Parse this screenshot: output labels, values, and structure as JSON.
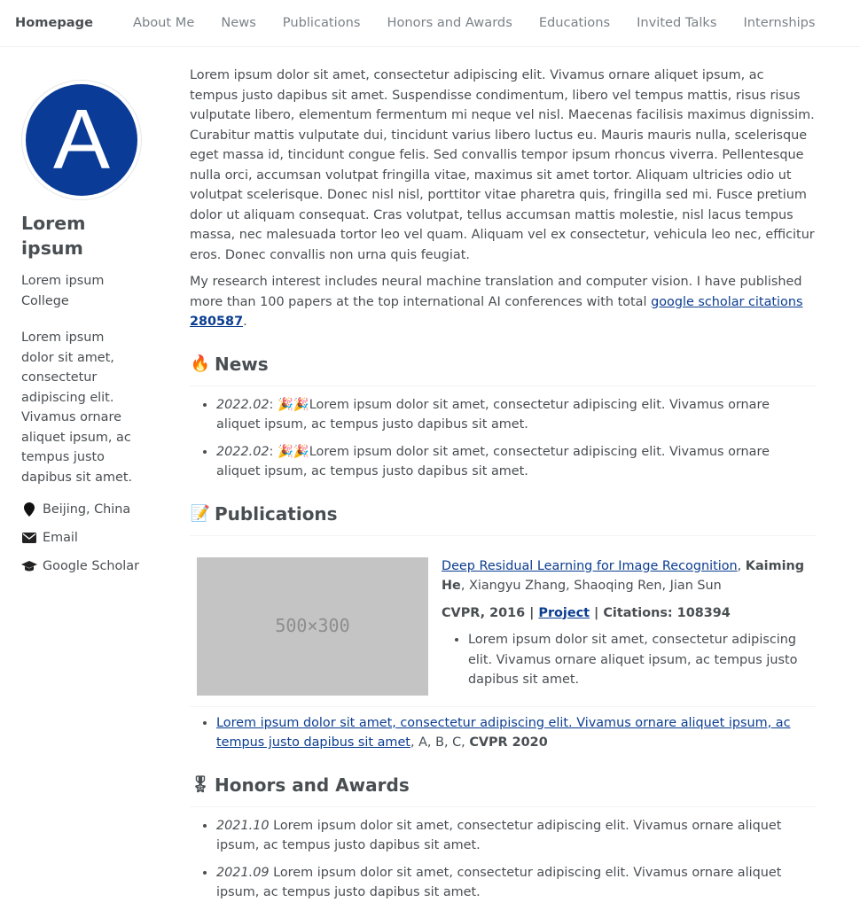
{
  "nav": {
    "home": "Homepage",
    "items": [
      "About Me",
      "News",
      "Publications",
      "Honors and Awards",
      "Educations",
      "Invited Talks",
      "Internships"
    ]
  },
  "sidebar": {
    "avatar_letter": "A",
    "avatar_color": "#0a3b97",
    "name": "Lorem ipsum",
    "affiliation": "Lorem ipsum College",
    "bio": "Lorem ipsum dolor sit amet, consectetur adipiscing elit. Vivamus ornare aliquet ipsum, ac tempus justo dapibus sit amet.",
    "location": "Beijing, China",
    "email_label": "Email",
    "scholar_label": "Google Scholar"
  },
  "about": {
    "paragraph1": "Lorem ipsum dolor sit amet, consectetur adipiscing elit. Vivamus ornare aliquet ipsum, ac tempus justo dapibus sit amet. Suspendisse condimentum, libero vel tempus mattis, risus risus vulputate libero, elementum fermentum mi neque vel nisl. Maecenas facilisis maximus dignissim. Curabitur mattis vulputate dui, tincidunt varius libero luctus eu. Mauris mauris nulla, scelerisque eget massa id, tincidunt congue felis. Sed convallis tempor ipsum rhoncus viverra. Pellentesque nulla orci, accumsan volutpat fringilla vitae, maximus sit amet tortor. Aliquam ultricies odio ut volutpat scelerisque. Donec nisl nisl, porttitor vitae pharetra quis, fringilla sed mi. Fusce pretium dolor ut aliquam consequat. Cras volutpat, tellus accumsan mattis molestie, nisl lacus tempus massa, nec malesuada tortor leo vel quam. Aliquam vel ex consectetur, vehicula leo nec, efficitur eros. Donec convallis non urna quis feugiat.",
    "paragraph2_prefix": "My research interest includes neural machine translation and computer vision. I have published more than 100 papers at the top international AI conferences with total ",
    "citations_link_text": "google scholar citations ",
    "citations_count": "280587",
    "paragraph2_suffix": "."
  },
  "news": {
    "title": "News",
    "emoji": "🔥",
    "items": [
      {
        "date": "2022.02",
        "sep": ": ",
        "emoji": "🎉🎉",
        "text": "Lorem ipsum dolor sit amet, consectetur adipiscing elit. Vivamus ornare aliquet ipsum, ac tempus justo dapibus sit amet."
      },
      {
        "date": "2022.02",
        "sep": ": ",
        "emoji": "🎉🎉",
        "text": "Lorem ipsum dolor sit amet, consectetur adipiscing elit. Vivamus ornare aliquet ipsum, ac tempus justo dapibus sit amet."
      }
    ]
  },
  "publications": {
    "title": "Publications",
    "emoji": "📝",
    "featured": {
      "image_text": "500×300",
      "title": "Deep Residual Learning for Image Recognition",
      "first_author": "Kaiming He",
      "other_authors": "Xiangyu Zhang, Shaoqing Ren, Jian Sun",
      "venue": "CVPR, 2016",
      "sep1": " | ",
      "project_label": "Project",
      "sep2": " | ",
      "citations": "Citations: 108394",
      "summary": "Lorem ipsum dolor sit amet, consectetur adipiscing elit. Vivamus ornare aliquet ipsum, ac tempus justo dapibus sit amet."
    },
    "list": [
      {
        "title": "Lorem ipsum dolor sit amet, consectetur adipiscing elit. Vivamus ornare aliquet ipsum, ac tempus justo dapibus sit amet",
        "authors": ", A, B, C, ",
        "venue": "CVPR 2020"
      }
    ]
  },
  "honors": {
    "title": "Honors and Awards",
    "emoji": "🎖",
    "items": [
      {
        "date": "2021.10",
        "text": " Lorem ipsum dolor sit amet, consectetur adipiscing elit. Vivamus ornare aliquet ipsum, ac tempus justo dapibus sit amet."
      },
      {
        "date": "2021.09",
        "text": " Lorem ipsum dolor sit amet, consectetur adipiscing elit. Vivamus ornare aliquet ipsum, ac tempus justo dapibus sit amet."
      }
    ]
  }
}
